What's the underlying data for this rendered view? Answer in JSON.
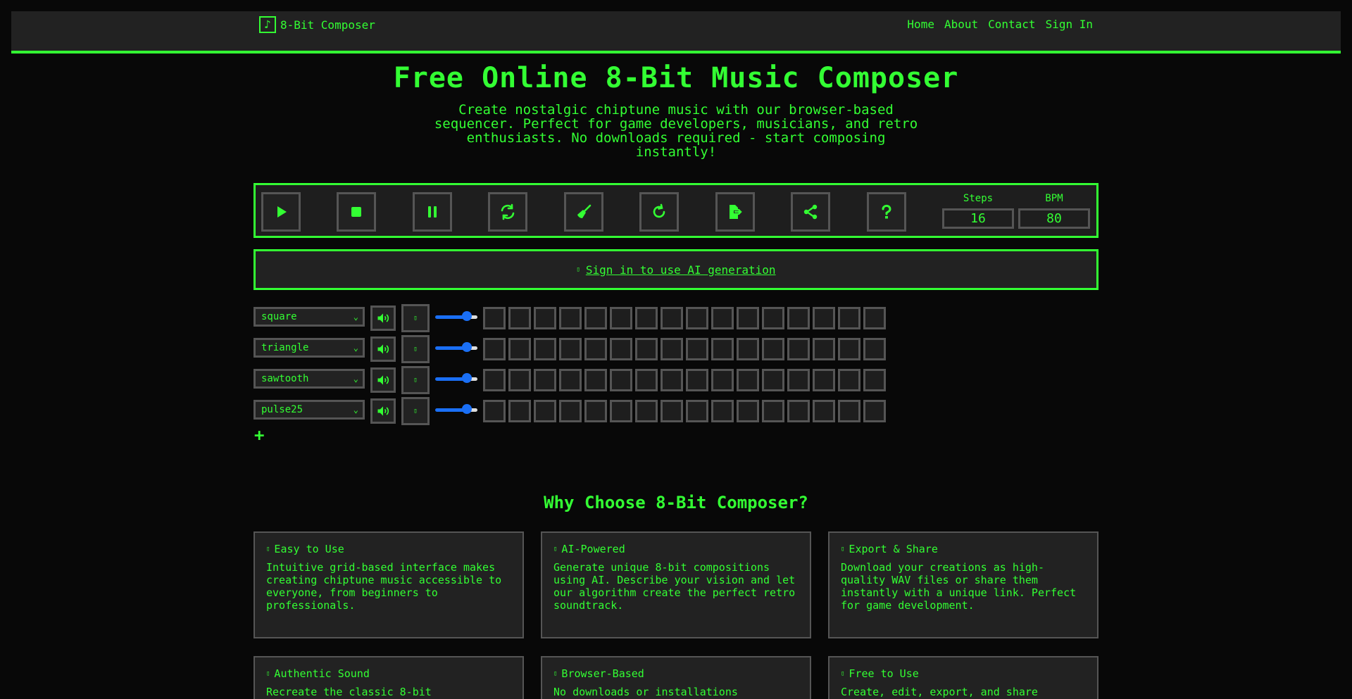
{
  "nav": {
    "logo_glyph": "♪",
    "brand": "8-Bit Composer",
    "links": [
      "Home",
      "About",
      "Contact",
      "Sign In"
    ]
  },
  "hero": {
    "title": "Free Online 8-Bit Music Composer",
    "subtitle": "Create nostalgic chiptune music with our browser-based sequencer. Perfect for game developers, musicians, and retro enthusiasts. No downloads required - start composing instantly!"
  },
  "toolbar": {
    "buttons": [
      "play-icon",
      "stop-icon",
      "pause-icon",
      "loop-icon",
      "clear-icon",
      "redo-icon",
      "export-icon",
      "share-icon",
      "help-icon"
    ],
    "steps_label": "Steps",
    "steps_value": "16",
    "bpm_label": "BPM",
    "bpm_value": "80"
  },
  "ai_banner": {
    "glyph": "▯",
    "text": "Sign in to use AI generation"
  },
  "tracks": [
    {
      "wave": "square",
      "solo_glyph": "▯",
      "volume": 0.75
    },
    {
      "wave": "triangle",
      "solo_glyph": "▯",
      "volume": 0.75
    },
    {
      "wave": "sawtooth",
      "solo_glyph": "▯",
      "volume": 0.75
    },
    {
      "wave": "pulse25",
      "solo_glyph": "▯",
      "volume": 0.75
    }
  ],
  "steps_per_track": 16,
  "add_track_glyph": "+",
  "features": {
    "title": "Why Choose 8-Bit Composer?",
    "cards": [
      {
        "glyph": "▯",
        "title": "Easy to Use",
        "text": "Intuitive grid-based interface makes creating chiptune music accessible to everyone, from beginners to professionals."
      },
      {
        "glyph": "▯",
        "title": "AI-Powered",
        "text": "Generate unique 8-bit compositions using AI. Describe your vision and let our algorithm create the perfect retro soundtrack."
      },
      {
        "glyph": "▯",
        "title": "Export & Share",
        "text": "Download your creations as high-quality WAV files or share them instantly with a unique link. Perfect for game development."
      },
      {
        "glyph": "▯",
        "title": "Authentic Sound",
        "text": "Recreate the classic 8-bit"
      },
      {
        "glyph": "▯",
        "title": "Browser-Based",
        "text": "No downloads or installations"
      },
      {
        "glyph": "▯",
        "title": "Free to Use",
        "text": "Create, edit, export, and share"
      }
    ]
  },
  "colors": {
    "accent": "#33ff33",
    "background": "#080808",
    "panel": "#222222",
    "border": "#555555",
    "slider": "#1a6ff5"
  }
}
